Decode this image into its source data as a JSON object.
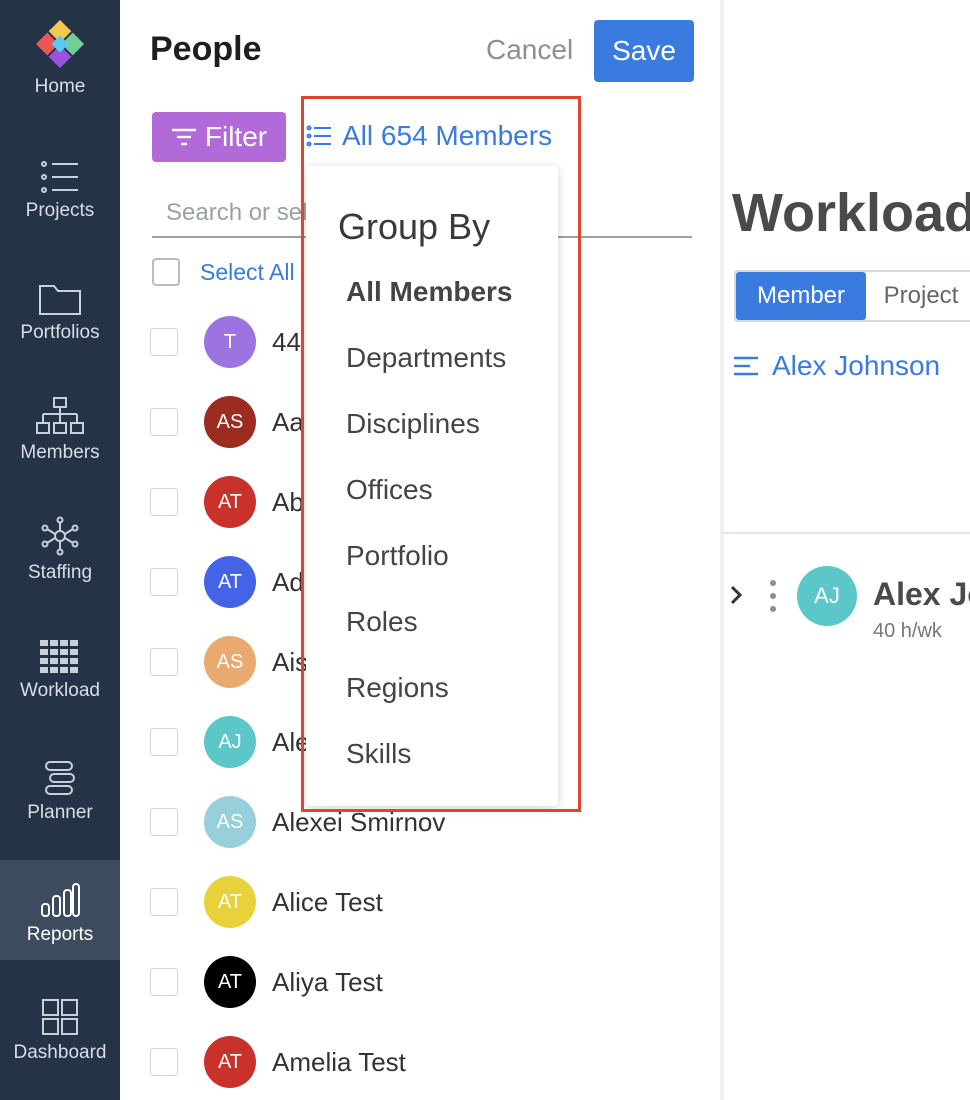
{
  "sidebar": {
    "items": [
      {
        "label": "Home",
        "icon": "logo-icon"
      },
      {
        "label": "Projects",
        "icon": "list-icon"
      },
      {
        "label": "Portfolios",
        "icon": "folder-icon"
      },
      {
        "label": "Members",
        "icon": "org-chart-icon"
      },
      {
        "label": "Staffing",
        "icon": "network-icon"
      },
      {
        "label": "Workload",
        "icon": "grid-icon"
      },
      {
        "label": "Planner",
        "icon": "gantt-icon"
      },
      {
        "label": "Reports",
        "icon": "bar-chart-icon",
        "active": true
      },
      {
        "label": "Dashboard",
        "icon": "dashboard-icon"
      }
    ]
  },
  "people_panel": {
    "title": "People",
    "cancel_label": "Cancel",
    "save_label": "Save",
    "filter_label": "Filter",
    "members_toggle_label": "All 654 Members",
    "search_placeholder": "Search or select",
    "select_all_label": "Select All",
    "members": [
      {
        "initials": "T",
        "name": "44",
        "color": "#9b74e0"
      },
      {
        "initials": "AS",
        "name": "Aa",
        "color": "#9c2b20"
      },
      {
        "initials": "AT",
        "name": "Ab",
        "color": "#c9322a"
      },
      {
        "initials": "AT",
        "name": "Ad",
        "color": "#4563e6"
      },
      {
        "initials": "AS",
        "name": "Ais",
        "color": "#e8aa6e"
      },
      {
        "initials": "AJ",
        "name": "Ale",
        "color": "#5bc7c8"
      },
      {
        "initials": "AS",
        "name": "Alexei Smirnov",
        "color": "#97cfda"
      },
      {
        "initials": "AT",
        "name": "Alice Test",
        "color": "#e8d23a"
      },
      {
        "initials": "AT",
        "name": "Aliya Test",
        "color": "#000000"
      },
      {
        "initials": "AT",
        "name": "Amelia Test",
        "color": "#c9322a"
      }
    ]
  },
  "group_by_dropdown": {
    "title": "Group By",
    "options": [
      "All Members",
      "Departments",
      "Disciplines",
      "Offices",
      "Portfolio",
      "Roles",
      "Regions",
      "Skills"
    ],
    "selected": "All Members"
  },
  "workload_panel": {
    "title": "Workload",
    "tabs": [
      "Member",
      "Project"
    ],
    "active_tab": "Member",
    "selected_user": "Alex Johnson",
    "row": {
      "initials": "AJ",
      "name": "Alex Johnson",
      "hours": "40 h/wk"
    }
  },
  "colors": {
    "sidebar_bg": "#253346",
    "accent_blue": "#3a7be0",
    "filter_purple": "#b26ad8",
    "highlight_red": "#e04330"
  }
}
